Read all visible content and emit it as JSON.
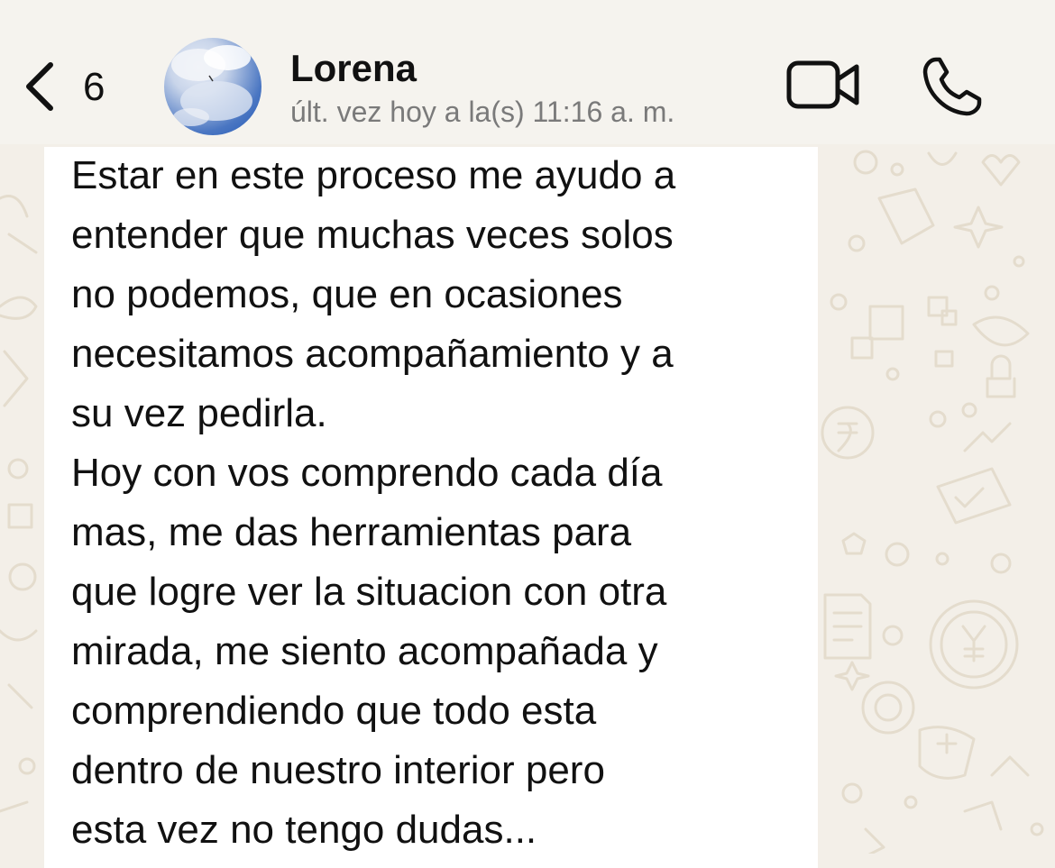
{
  "header": {
    "back_count": "6",
    "contact_name": "Lorena",
    "last_seen": "últ. vez hoy a la(s) 11:16 a. m."
  },
  "icons": {
    "back": "chevron-left-icon",
    "video": "video-camera-icon",
    "call": "phone-icon"
  },
  "colors": {
    "header_bg": "#f5f3ee",
    "chat_bg": "#f3efe8",
    "bubble_bg": "#ffffff",
    "text": "#111111",
    "subtext": "#7a7a7a"
  },
  "message": {
    "lines": [
      "Estar en este proceso me ayudo a",
      "entender que muchas veces solos",
      "no podemos, que en ocasiones",
      "necesitamos acompañamiento y a",
      "su vez pedirla.",
      "Hoy con vos comprendo cada día",
      "mas, me das herramientas para",
      "que logre ver la situacion con otra",
      "mirada, me siento acompañada y",
      "comprendiendo que todo esta",
      "dentro de nuestro interior pero",
      "esta vez no tengo dudas..."
    ]
  }
}
